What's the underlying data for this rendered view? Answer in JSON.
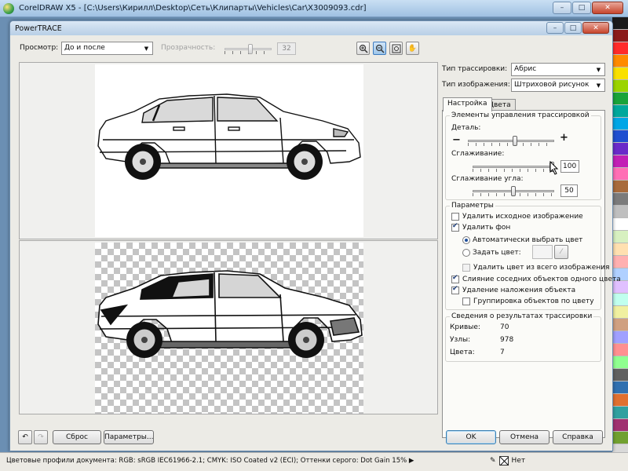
{
  "app": {
    "title": "CorelDRAW X5 - [C:\\Users\\Кирилл\\Desktop\\Сеть\\Клипарты\\Vehicles\\Car\\X3009093.cdr]",
    "window_buttons": {
      "minimize": "–",
      "maximize": "□",
      "close": "✕"
    }
  },
  "dialog": {
    "title": "PowerTRACE",
    "window_buttons": {
      "minimize": "–",
      "maximize": "□",
      "close": "✕"
    },
    "toolbar": {
      "preview_label": "Просмотр:",
      "preview_value": "До и после",
      "transparency_label": "Прозрачность:",
      "transparency_value": "32",
      "transparency_level": 0.55,
      "zoom_in_icon": "zoom-in-icon",
      "zoom_out_icon": "zoom-out-icon",
      "fit_icon": "fit-to-window-icon",
      "pan_icon": "hand-pan-icon"
    },
    "trace_type_label": "Тип трассировки:",
    "trace_type_value": "Абрис",
    "image_type_label": "Тип изображения:",
    "image_type_value": "Штриховой рисунок",
    "tabs": [
      {
        "label": "Настройка",
        "active": true
      },
      {
        "label": "Цвета",
        "active": false
      }
    ],
    "controls": {
      "group_title": "Элементы управления трассировкой",
      "detail_label": "Деталь:",
      "detail_minus": "−",
      "detail_plus": "+",
      "detail_level": 0.55,
      "smoothing_label": "Сглаживание:",
      "smoothing_value": "100",
      "smoothing_level": 1.0,
      "corner_label": "Сглаживание угла:",
      "corner_value": "50",
      "corner_level": 0.5
    },
    "params": {
      "group_title": "Параметры",
      "remove_original": {
        "label": "Удалить исходное изображение",
        "checked": false
      },
      "remove_background": {
        "label": "Удалить фон",
        "checked": true
      },
      "auto_color": {
        "label": "Автоматически выбрать цвет",
        "selected": true
      },
      "set_color": {
        "label": "Задать цвет:",
        "selected": false
      },
      "remove_color_all": {
        "label": "Удалить цвет из всего изображения",
        "checked": false
      },
      "merge_adjacent": {
        "label": "Слияние соседних объектов одного цвета",
        "checked": true
      },
      "remove_overlap": {
        "label": "Удаление наложения объекта",
        "checked": true
      },
      "group_by_color": {
        "label": "Группировка объектов по цвету",
        "checked": false
      }
    },
    "results": {
      "group_title": "Сведения о результатах трассировки",
      "rows": [
        {
          "label": "Кривые:",
          "value": "70"
        },
        {
          "label": "Узлы:",
          "value": "978"
        },
        {
          "label": "Цвета:",
          "value": "7"
        }
      ]
    },
    "bottom": {
      "undo_icon": "undo-icon",
      "redo_icon": "redo-icon",
      "reset_label": "Сброс",
      "options_label": "Параметры...",
      "ok_label": "OK",
      "cancel_label": "Отмена",
      "help_label": "Справка"
    }
  },
  "statusbar": {
    "profiles": "Цветовые профили документа: RGB: sRGB IEC61966-2.1; CMYK: ISO Coated v2 (ECI); Оттенки серого: Dot Gain 15%",
    "arrow": "▶",
    "fill_label": "Нет"
  },
  "palette_colors": [
    "#1a1a1a",
    "#8b1a1a",
    "#ff2a2a",
    "#ff8a00",
    "#f9e000",
    "#9bd400",
    "#19a33a",
    "#00a89c",
    "#00a6e6",
    "#1f4fd0",
    "#6a2ac9",
    "#c21fb5",
    "#ff6fb5",
    "#a86b3c",
    "#7b7b7b",
    "#bfbfbf",
    "#ffffff",
    "#d7f0c0",
    "#ffe0b0",
    "#ffb0b0",
    "#b0d0ff",
    "#e0c0ff",
    "#c0ffee",
    "#f0f0a0",
    "#d0a080",
    "#a0a0ff",
    "#ff9090",
    "#90ff90",
    "#606060",
    "#3070b0",
    "#e07030",
    "#30a0a0",
    "#a03070",
    "#70a030"
  ]
}
